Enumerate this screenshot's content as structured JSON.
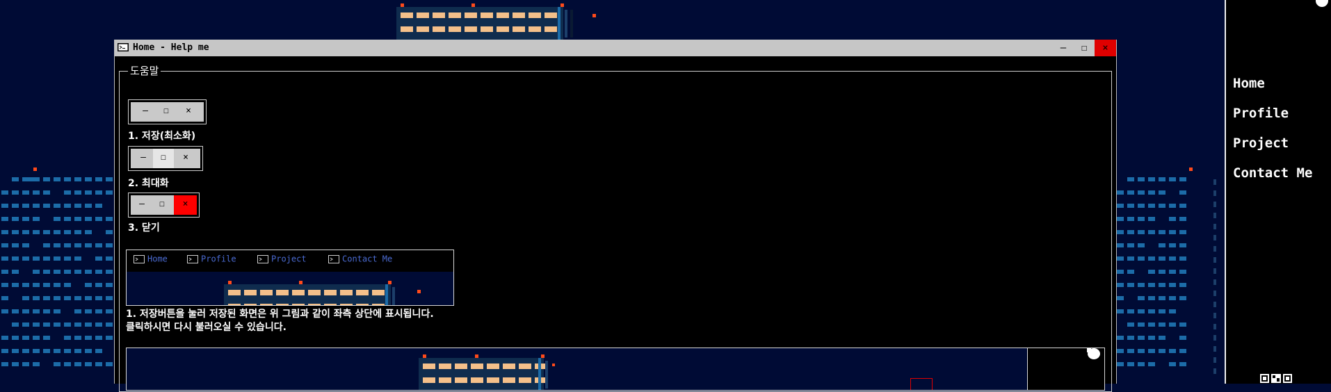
{
  "window": {
    "title": "Home - Help me",
    "minimize": "–",
    "maximize": "☐",
    "close": "×"
  },
  "help": {
    "legend": "도움말",
    "controls": [
      {
        "label": "1. 저장(최소화)",
        "glyphs": [
          "–",
          "☐",
          "×"
        ],
        "highlight": false
      },
      {
        "label": "2. 최대화",
        "glyphs": [
          "–",
          "☐",
          "×"
        ],
        "highlight": false
      },
      {
        "label": "3. 닫기",
        "glyphs": [
          "–",
          "☐",
          "×"
        ],
        "highlight": true
      }
    ],
    "preview_tabs": [
      "Home",
      "Profile",
      "Project",
      "Contact Me"
    ],
    "description": [
      "1. 저장버튼을 눌러 저장된 화면은 위 그림과 같이 좌측 상단에 표시됩니다.",
      "클릭하시면 다시 불러오실 수 있습니다."
    ]
  },
  "nav": {
    "items": [
      "Home",
      "Profile",
      "Project",
      "Contact Me"
    ]
  },
  "colors": {
    "sky": "#000b35",
    "window_bg": "#000000",
    "titlebar": "#c6c6c6",
    "close_red": "#e00000",
    "tab_text": "#4a6ad0",
    "window_light": "#f4c08a",
    "building": "#0f2c4e",
    "window_blue": "#1c6ca8",
    "antenna_red": "#ff4a1a"
  },
  "icons": {
    "window_icon": "terminal-window-icon",
    "tab_icon": "terminal-window-icon"
  }
}
